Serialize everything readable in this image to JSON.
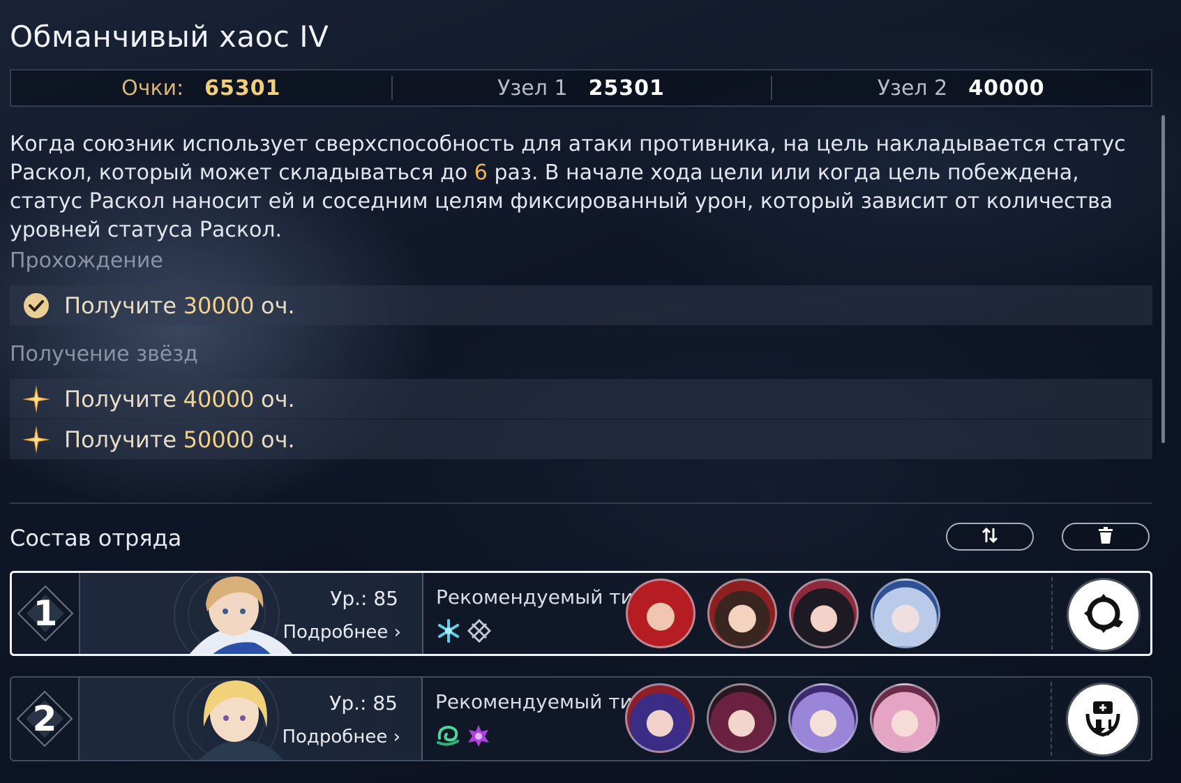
{
  "title": "Обманчивый хаос IV",
  "scores": {
    "total_label": "Очки:",
    "total_value": "65301",
    "node1_label": "Узел 1",
    "node1_value": "25301",
    "node2_label": "Узел 2",
    "node2_value": "40000"
  },
  "description": {
    "part1": "Когда союзник использует сверхспособность для атаки противника, на цель накладывается статус Раскол, который может складываться до",
    "highlight": "6",
    "part2": "раз. В начале хода цели или когда цель побеждена, статус Раскол наносит ей и соседним целям фиксированный урон, который зависит от количества уровней статуса Раскол."
  },
  "clear": {
    "heading": "Прохождение",
    "task": {
      "prefix": "Получите",
      "value": "30000",
      "suffix": "оч.",
      "icon": "check-circle-icon"
    }
  },
  "stars": {
    "heading": "Получение звёзд",
    "tasks": [
      {
        "prefix": "Получите",
        "value": "40000",
        "suffix": "оч.",
        "icon": "star-icon"
      },
      {
        "prefix": "Получите",
        "value": "50000",
        "suffix": "оч.",
        "icon": "star-icon"
      }
    ]
  },
  "team": {
    "heading": "Состав отряда",
    "swap_icon": "swap-arrows-icon",
    "delete_icon": "trash-icon",
    "nodes": [
      {
        "number": "1",
        "level": "Ур.: 85",
        "details": "Подробнее",
        "recommended_label": "Рекомендуемый тип",
        "type_icons": [
          "ice-icon",
          "quantum-icon"
        ],
        "action_icon": "auto-cycle-icon",
        "active": true
      },
      {
        "number": "2",
        "level": "Ур.: 85",
        "details": "Подробнее",
        "recommended_label": "Рекомендуемый тип",
        "type_icons": [
          "wind-icon",
          "imaginary-icon"
        ],
        "action_icon": "download-icon",
        "active": false
      }
    ]
  },
  "colors": {
    "accent_gold": "#f3cf7c",
    "highlight": "#f2b84e"
  }
}
